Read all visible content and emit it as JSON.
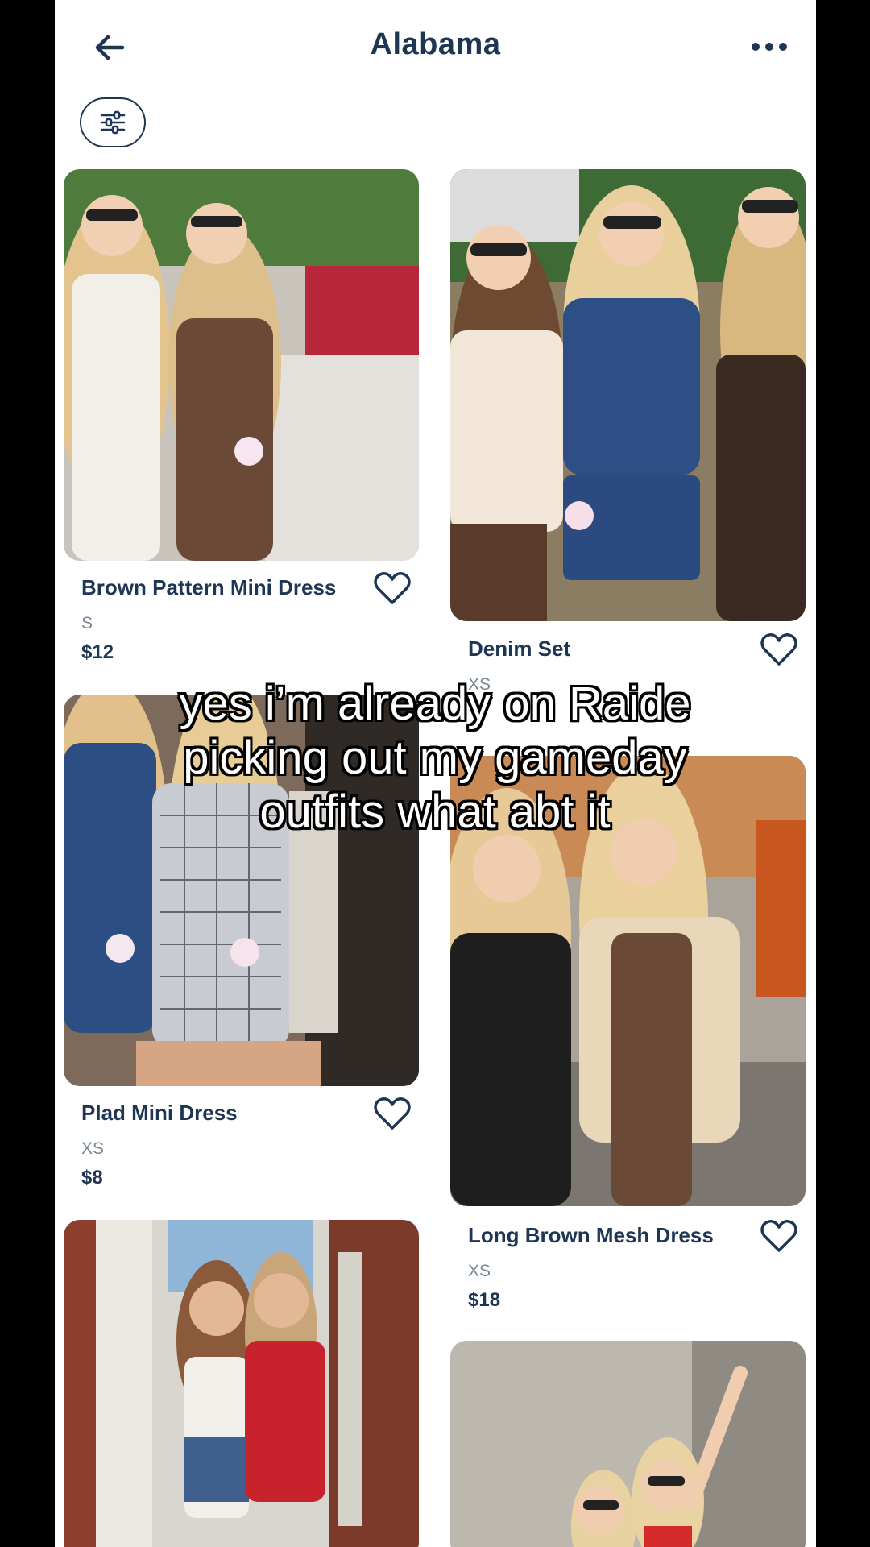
{
  "header": {
    "title": "Alabama"
  },
  "products": [
    {
      "title": "Brown Pattern Mini Dress",
      "size": "S",
      "price": "$12"
    },
    {
      "title": "Denim Set",
      "size": "XS",
      "price": ""
    },
    {
      "title": "Plad Mini Dress",
      "size": "XS",
      "price": "$8"
    },
    {
      "title": "Long Brown Mesh Dress",
      "size": "XS",
      "price": "$18"
    }
  ],
  "caption": {
    "line1": "yes i’m already on Raide",
    "line2": "picking out my gameday",
    "line3": "outfits what abt it"
  },
  "colors": {
    "accent": "#1e3554",
    "muted": "#7a8595"
  }
}
